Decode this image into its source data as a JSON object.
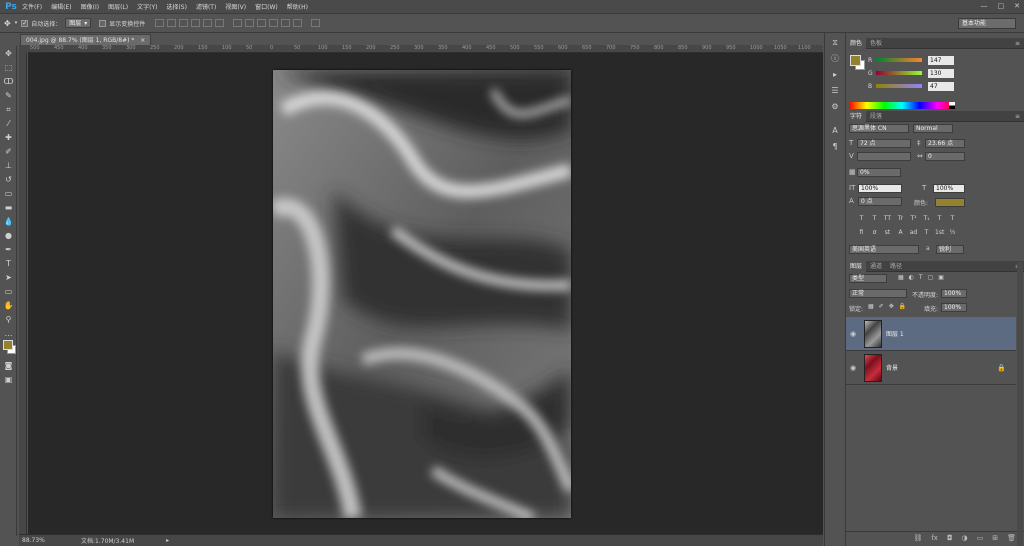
{
  "app": {
    "logo": "Ps",
    "menus": [
      "文件(F)",
      "编辑(E)",
      "图像(I)",
      "图层(L)",
      "文字(Y)",
      "选择(S)",
      "滤镜(T)",
      "视图(V)",
      "窗口(W)",
      "帮助(H)"
    ],
    "window_controls": [
      "—",
      "□",
      "✕"
    ]
  },
  "options_bar": {
    "auto_select_label": "自动选择：",
    "auto_select_value": "图层",
    "show_transform_label": "显示变换控件",
    "workspace": "基本功能"
  },
  "document": {
    "tab_title": "004.jpg @ 88.7% (图层 1, RGB/8#) *",
    "tab_close": "×",
    "zoom": "88.73%",
    "doc_info": "文档:1.70M/3.41M",
    "ruler_ticks": [
      "500",
      "450",
      "400",
      "350",
      "300",
      "250",
      "200",
      "150",
      "100",
      "50",
      "0",
      "50",
      "100",
      "150",
      "200",
      "250",
      "300",
      "350",
      "400",
      "450",
      "500",
      "550",
      "600",
      "650",
      "700",
      "750",
      "800",
      "850",
      "900",
      "950",
      "1000",
      "1050",
      "1100",
      "1150"
    ]
  },
  "color_panel": {
    "tabs": [
      "颜色",
      "色板"
    ],
    "channels": [
      {
        "label": "R",
        "value": "147",
        "color": "#93822f"
      },
      {
        "label": "G",
        "value": "130",
        "color": "#93822f"
      },
      {
        "label": "B",
        "value": "47",
        "color": "#93822f"
      }
    ],
    "foreground": "#93822f"
  },
  "character_panel": {
    "tabs": [
      "字符",
      "段落"
    ],
    "font_family": "思源黑体 CN",
    "font_style": "Normal",
    "font_size": "72 点",
    "leading": "23.66 点",
    "kerning": "",
    "tracking": "0",
    "scale_pct": "0%",
    "vertical_scale": "100%",
    "horizontal_scale": "100%",
    "baseline": "0 点",
    "color_label": "颜色:",
    "text_color": "#93822f",
    "style_buttons": [
      "T",
      "T",
      "TT",
      "Tr",
      "T¹",
      "T₁",
      "T",
      "T"
    ],
    "ot_buttons": [
      "fi",
      "σ",
      "st",
      "A",
      "ad",
      "T",
      "1st",
      "½"
    ],
    "language": "美国英语",
    "antialias_label": "a",
    "antialias": "锐利"
  },
  "layers_panel": {
    "tabs": [
      "图层",
      "通道",
      "路径"
    ],
    "filter_label": "类型",
    "blend_mode": "正常",
    "opacity_label": "不透明度:",
    "opacity": "100%",
    "lock_label": "锁定:",
    "fill_label": "填充:",
    "fill": "100%",
    "layers": [
      {
        "name": "图层 1",
        "selected": true
      },
      {
        "name": "背景",
        "selected": false
      }
    ],
    "bottom_icons": [
      "link-icon",
      "fx-icon",
      "mask-icon",
      "adjustment-icon",
      "group-icon",
      "new-layer-icon",
      "trash-icon"
    ]
  }
}
